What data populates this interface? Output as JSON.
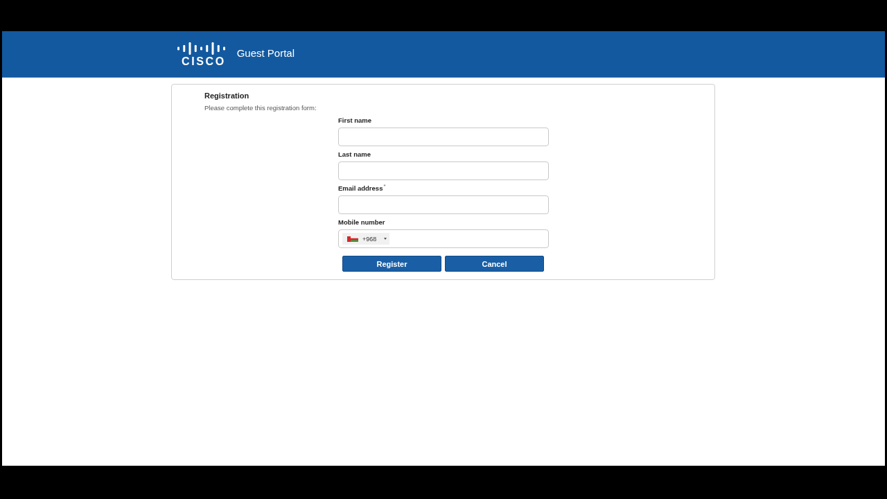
{
  "header": {
    "logo_text": "CISCO",
    "title": "Guest Portal"
  },
  "form": {
    "title": "Registration",
    "instructions": "Please complete this registration form:",
    "fields": [
      {
        "kind": "text",
        "label": "First name"
      },
      {
        "kind": "text",
        "label": "Last name"
      },
      {
        "kind": "text",
        "label": "Email address$^{*}$"
      },
      {
        "kind": "phone",
        "label": "Mobile number",
        "country_code": "+968"
      }
    ],
    "buttons": [
      {
        "label": "Register"
      },
      {
        "label": "Cancel"
      }
    ]
  }
}
